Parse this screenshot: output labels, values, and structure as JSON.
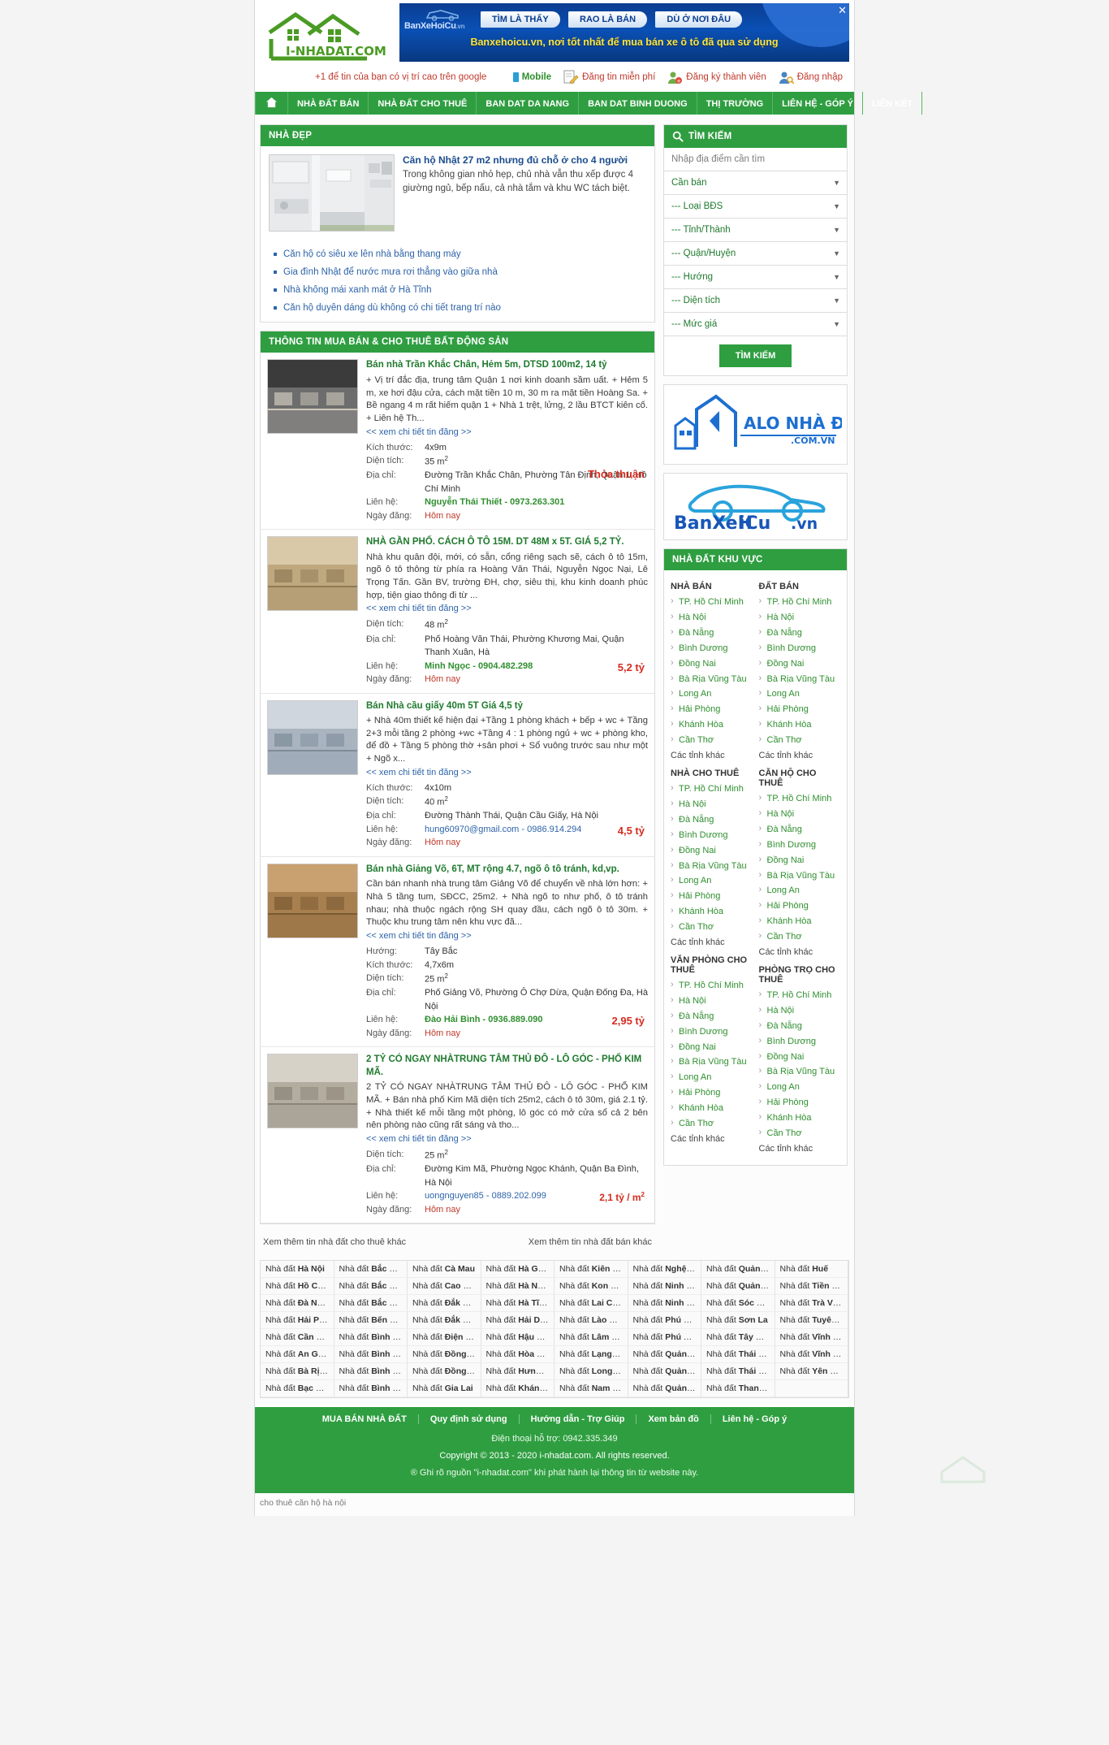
{
  "site": {
    "logo_text": "I-NHADAT.COM",
    "gplus_note": "+1 để tin của bạn có vị trí cao trên google"
  },
  "banner": {
    "brand": "BanXeHoiCu",
    "brand_tld": ".vn",
    "pills": [
      "TÌM LÀ THẤY",
      "RAO LÀ BÁN",
      "DÙ Ở NƠI ĐÂU"
    ],
    "tagline": "Banxehoicu.vn, nơi tốt nhất để mua bán xe ô tô đã qua sử dụng",
    "close": "✕"
  },
  "topbar": {
    "mobile": "Mobile",
    "post_free": "Đăng tin miễn phí",
    "register": "Đăng ký thành viên",
    "login": "Đăng nhập"
  },
  "nav": {
    "home_icon": "home-icon",
    "items": [
      "NHÀ ĐẤT BÁN",
      "NHÀ ĐẤT CHO THUÊ",
      "BAN DAT DA NANG",
      "BAN DAT BINH DUONG",
      "THỊ TRƯỜNG",
      "LIÊN HỆ - GÓP Ý",
      "LIÊN KẾT"
    ]
  },
  "nice_house": {
    "panel_title": "NHÀ ĐẸP",
    "title": "Căn hộ Nhật 27 m2 nhưng đủ chỗ ở cho 4 người",
    "desc": "Trong không gian nhỏ hẹp, chủ nhà vẫn thu xếp được 4 giường ngủ, bếp nấu, cả nhà tắm và khu WC tách biệt.",
    "links": [
      "Căn hộ có siêu xe lên nhà bằng thang máy",
      "Gia đình Nhật để nước mưa rơi thẳng vào giữa nhà",
      "Nhà không mái xanh mát ở Hà Tĩnh",
      "Căn hộ duyên dáng dù không có chi tiết trang trí nào"
    ]
  },
  "listings": {
    "panel_title": "THÔNG TIN MUA BÁN & CHO THUÊ BẤT ĐỘNG SẢN",
    "more_left": "Xem thêm tin nhà đất cho thuê khác",
    "more_right": "Xem thêm tin nhà đất bán khác",
    "labels": {
      "size": "Kích thước:",
      "area": "Diện tích:",
      "address": "Địa chỉ:",
      "contact": "Liên hệ:",
      "posted": "Ngày đăng:",
      "direction": "Hướng:",
      "detail_link": "<< xem chi tiết tin đăng >>"
    },
    "items": [
      {
        "title": "Bán nhà Trần Khắc Chân, Hẻm 5m, DTSD 100m2, 14 tỷ",
        "desc": "+ Vị trí đắc địa, trung tâm Quận 1 nơi kinh doanh sầm uất. + Hẻm 5 m, xe hơi đậu cửa, cách mặt tiền 10 m, 30 m ra mặt tiền Hoàng Sa. + Bề ngang 4 m rất hiếm quận 1 + Nhà 1 trệt, lửng, 2 lầu BTCT kiên cố. + Liên hệ Th...",
        "price": "Thỏa thuận",
        "price_class": "thoa",
        "rows": [
          {
            "k": "Kích thước:",
            "v": "4x9m",
            "cls": ""
          },
          {
            "k": "Diện tích:",
            "v": "35 m2",
            "cls": "",
            "sup": "2"
          },
          {
            "k": "Địa chỉ:",
            "v": "Đường Trần Khắc Chân, Phường Tân Định, Quận 1, Hồ Chí Minh",
            "cls": ""
          },
          {
            "k": "Liên hệ:",
            "v": "Nguyễn Thái Thiết - 0973.263.301",
            "cls": "green"
          },
          {
            "k": "Ngày đăng:",
            "v": "Hôm nay",
            "cls": "red"
          }
        ]
      },
      {
        "title": "NHÀ GẦN PHỐ. CÁCH Ô TÔ 15M. DT 48M x 5T. GIÁ 5,2 TỶ.",
        "desc": "Nhà khu quân đội, mới, có sẵn, cổng riêng sạch sẽ, cách ô tô 15m, ngõ ô tô thông từ phía ra Hoàng Văn Thái, Nguyễn Ngọc Nại, Lê Trọng Tấn. Gần BV, trường ĐH, chợ, siêu thị, khu kinh doanh phúc hợp, tiện giao thông đi từ ...",
        "price": "5,2 tỷ",
        "price_class": "",
        "rows": [
          {
            "k": "Diện tích:",
            "v": "48 m2",
            "cls": "",
            "sup": "2"
          },
          {
            "k": "Địa chỉ:",
            "v": "Phố Hoàng Văn Thái, Phường Khương Mai, Quận Thanh Xuân, Hà",
            "cls": ""
          },
          {
            "k": "Liên hệ:",
            "v": "Minh Ngọc - 0904.482.298",
            "cls": "green"
          },
          {
            "k": "Ngày đăng:",
            "v": "Hôm nay",
            "cls": "red"
          }
        ]
      },
      {
        "title": "Bán Nhà cầu giấy 40m 5T Giá 4,5 tỷ",
        "desc": "+ Nhà 40m thiết kế hiện đại +Tầng 1 phòng khách + bếp + wc + Tầng 2+3 mỗi tầng 2 phòng +wc +Tầng 4 : 1 phòng ngủ + wc + phòng kho, để đồ + Tầng 5 phòng thờ +sân phơi + Sổ vuông trước sau như một + Ngõ x...",
        "price": "4,5 tỷ",
        "price_class": "",
        "rows": [
          {
            "k": "Kích thước:",
            "v": "4x10m",
            "cls": ""
          },
          {
            "k": "Diện tích:",
            "v": "40 m2",
            "cls": "",
            "sup": "2"
          },
          {
            "k": "Địa chỉ:",
            "v": "Đường Thành Thái, Quận Cầu Giấy, Hà Nội",
            "cls": ""
          },
          {
            "k": "Liên hệ:",
            "v": "hung60970@gmail.com - 0986.914.294",
            "cls": "blue"
          },
          {
            "k": "Ngày đăng:",
            "v": "Hôm nay",
            "cls": "red"
          }
        ]
      },
      {
        "title": "Bán nhà Giảng Võ, 6T, MT rộng 4.7, ngõ ô tô tránh, kd,vp.",
        "desc": "Cần bán nhanh nhà trung tâm Giảng Võ để chuyển về nhà lớn hơn: + Nhà 5 tầng tum, SĐCC, 25m2. + Nhà ngõ to như phố, ô tô tránh nhau; nhà thuộc ngách rộng SH quay đầu, cách ngõ ô tô 30m. + Thuộc khu trung tâm nên khu vực đã...",
        "price": "2,95 tỷ",
        "price_class": "",
        "rows": [
          {
            "k": "Hướng:",
            "v": "Tây Bắc",
            "cls": ""
          },
          {
            "k": "Kích thước:",
            "v": "4,7x6m",
            "cls": ""
          },
          {
            "k": "Diện tích:",
            "v": "25 m2",
            "cls": "",
            "sup": "2"
          },
          {
            "k": "Địa chỉ:",
            "v": "Phố Giảng Võ, Phường Ô Chợ Dừa, Quận Đống Đa, Hà Nội",
            "cls": ""
          },
          {
            "k": "Liên hệ:",
            "v": "Đào Hải Bình - 0936.889.090",
            "cls": "green"
          },
          {
            "k": "Ngày đăng:",
            "v": "Hôm nay",
            "cls": "red"
          }
        ]
      },
      {
        "title": "2 TỶ CÓ NGAY NHÀTRUNG TÂM THỦ ĐÔ - LÔ GÓC - PHỐ KIM MÃ.",
        "desc": "2 TỶ CÓ NGAY NHÀTRUNG TÂM THỦ ĐÔ - LÔ GÓC - PHỐ KIM MÃ. + Bán nhà phố Kim Mã diện tích 25m2, cách ô tô 30m, giá 2.1 tỷ. + Nhà thiết kế mỗi tầng một phòng, lô góc có mở cửa sổ cả 2 bên nên phòng nào cũng rất sáng và tho...",
        "price": "2,1 tỷ / m2",
        "price_class": "small",
        "rows": [
          {
            "k": "Diện tích:",
            "v": "25 m2",
            "cls": "",
            "sup": "2"
          },
          {
            "k": "Địa chỉ:",
            "v": "Đường Kim Mã, Phường Ngọc Khánh, Quận Ba Đình, Hà Nội",
            "cls": ""
          },
          {
            "k": "Liên hệ:",
            "v": "uongnguyen85 - 0889.202.099",
            "cls": "blue"
          },
          {
            "k": "Ngày đăng:",
            "v": "Hôm nay",
            "cls": "red"
          }
        ]
      }
    ]
  },
  "search": {
    "title": "TÌM KIẾM",
    "icon": "search-icon",
    "placeholder": "Nhập địa điểm cần tìm",
    "selects": [
      "Cần bán",
      "--- Loại BĐS",
      "--- Tỉnh/Thành",
      "--- Quận/Huyện",
      "--- Hướng",
      "--- Diện tích",
      "--- Mức giá"
    ],
    "button": "TÌM KIẾM"
  },
  "ads": {
    "alo": {
      "brand": "ALO NHÀ ĐẤT",
      "tld": ".COM.VN"
    },
    "bxhc": {
      "brand_a": "BanXeH",
      "brand_b": "iCu",
      "tld": ".vn"
    }
  },
  "area": {
    "title": "NHÀ ĐẤT KHU VỰC",
    "groups": [
      {
        "heading": "NHÀ BÁN",
        "items": [
          "TP. Hồ Chí Minh",
          "Hà Nội",
          "Đà Nẵng",
          "Bình Dương",
          "Đồng Nai",
          "Bà Rịa Vũng Tàu",
          "Long An",
          "Hải Phòng",
          "Khánh Hòa",
          "Cần Thơ"
        ],
        "other": "Các tỉnh khác"
      },
      {
        "heading": "ĐẤT BÁN",
        "items": [
          "TP. Hồ Chí Minh",
          "Hà Nội",
          "Đà Nẵng",
          "Bình Dương",
          "Đồng Nai",
          "Bà Rịa Vũng Tàu",
          "Long An",
          "Hải Phòng",
          "Khánh Hòa",
          "Cần Thơ"
        ],
        "other": "Các tỉnh khác"
      },
      {
        "heading": "NHÀ CHO THUÊ",
        "items": [
          "TP. Hồ Chí Minh",
          "Hà Nội",
          "Đà Nẵng",
          "Bình Dương",
          "Đồng Nai",
          "Bà Rịa Vũng Tàu",
          "Long An",
          "Hải Phòng",
          "Khánh Hòa",
          "Cần Thơ"
        ],
        "other": "Các tỉnh khác"
      },
      {
        "heading": "CĂN HỘ CHO THUÊ",
        "items": [
          "TP. Hồ Chí Minh",
          "Hà Nội",
          "Đà Nẵng",
          "Bình Dương",
          "Đồng Nai",
          "Bà Rịa Vũng Tàu",
          "Long An",
          "Hải Phòng",
          "Khánh Hòa",
          "Cần Thơ"
        ],
        "other": "Các tỉnh khác"
      },
      {
        "heading": "VĂN PHÒNG CHO THUÊ",
        "items": [
          "TP. Hồ Chí Minh",
          "Hà Nội",
          "Đà Nẵng",
          "Bình Dương",
          "Đồng Nai",
          "Bà Rịa Vũng Tàu",
          "Long An",
          "Hải Phòng",
          "Khánh Hòa",
          "Cần Thơ"
        ],
        "other": "Các tỉnh khác"
      },
      {
        "heading": "PHÒNG TRỌ CHO THUÊ",
        "items": [
          "TP. Hồ Chí Minh",
          "Hà Nội",
          "Đà Nẵng",
          "Bình Dương",
          "Đồng Nai",
          "Bà Rịa Vũng Tàu",
          "Long An",
          "Hải Phòng",
          "Khánh Hòa",
          "Cần Thơ"
        ],
        "other": "Các tỉnh khác"
      }
    ]
  },
  "provinces": {
    "prefix": "Nhà đất ",
    "names": [
      "Hà Nội",
      "Hồ Chí Minh",
      "Đà Nẵng",
      "Hải Phòng",
      "Cần Thơ",
      "An Giang",
      "Bà Rịa Vũng",
      "Bạc Liêu",
      "Bắc Cạn",
      "Bắc Giang",
      "Bắc Ninh",
      "Bến Tre",
      "Bình Dương",
      "Bình Định",
      "Bình Phước",
      "Bình Thuận",
      "Cà Mau",
      "Cao Bằng",
      "Đắk Lắk",
      "Đắk Nông",
      "Điện Biên",
      "Đồng Nai",
      "Đồng Tháp",
      "Gia Lai",
      "Hà Giang",
      "Hà Nam",
      "Hà Tĩnh",
      "Hải Dương",
      "Hậu Giang",
      "Hòa Bình",
      "Hưng Yên",
      "Khánh Hòa",
      "Kiên Giang",
      "Kon Tum",
      "Lai Châu",
      "Lào Cai",
      "Lâm Đồng",
      "Lạng Sơn",
      "Long An",
      "Nam Định",
      "Nghệ An",
      "Ninh Bình",
      "Ninh Thuận",
      "Phú Thọ",
      "Phú Yên",
      "Quảng Bình",
      "Quảng Nam",
      "Quảng Ngãi",
      "Quảng Ninh",
      "Quảng Trị",
      "Sóc Trăng",
      "Sơn La",
      "Tây Ninh",
      "Thái Bình",
      "Thái Nguyên",
      "Thanh Hóa",
      "Huế",
      "Tiền Giang",
      "Trà Vinh",
      "Tuyên Quang",
      "Vĩnh Long",
      "Vĩnh Phúc",
      "Yên Bái"
    ]
  },
  "footer": {
    "links": [
      "MUA BÁN NHÀ ĐẤT",
      "Quy định sử dụng",
      "Hướng dẫn - Trợ Giúp",
      "Xem bản đồ",
      "Liên hệ - Góp ý"
    ],
    "phone": "Điện thoại hỗ trợ: 0942.335.349",
    "copyright": "Copyright © 2013 - 2020 i-nhadat.com. All rights reserved.",
    "note": "® Ghi rõ nguồn \"i-nhadat.com\" khi phát hành lại thông tin từ website này."
  },
  "tail": "cho thuê căn hộ hà nội"
}
